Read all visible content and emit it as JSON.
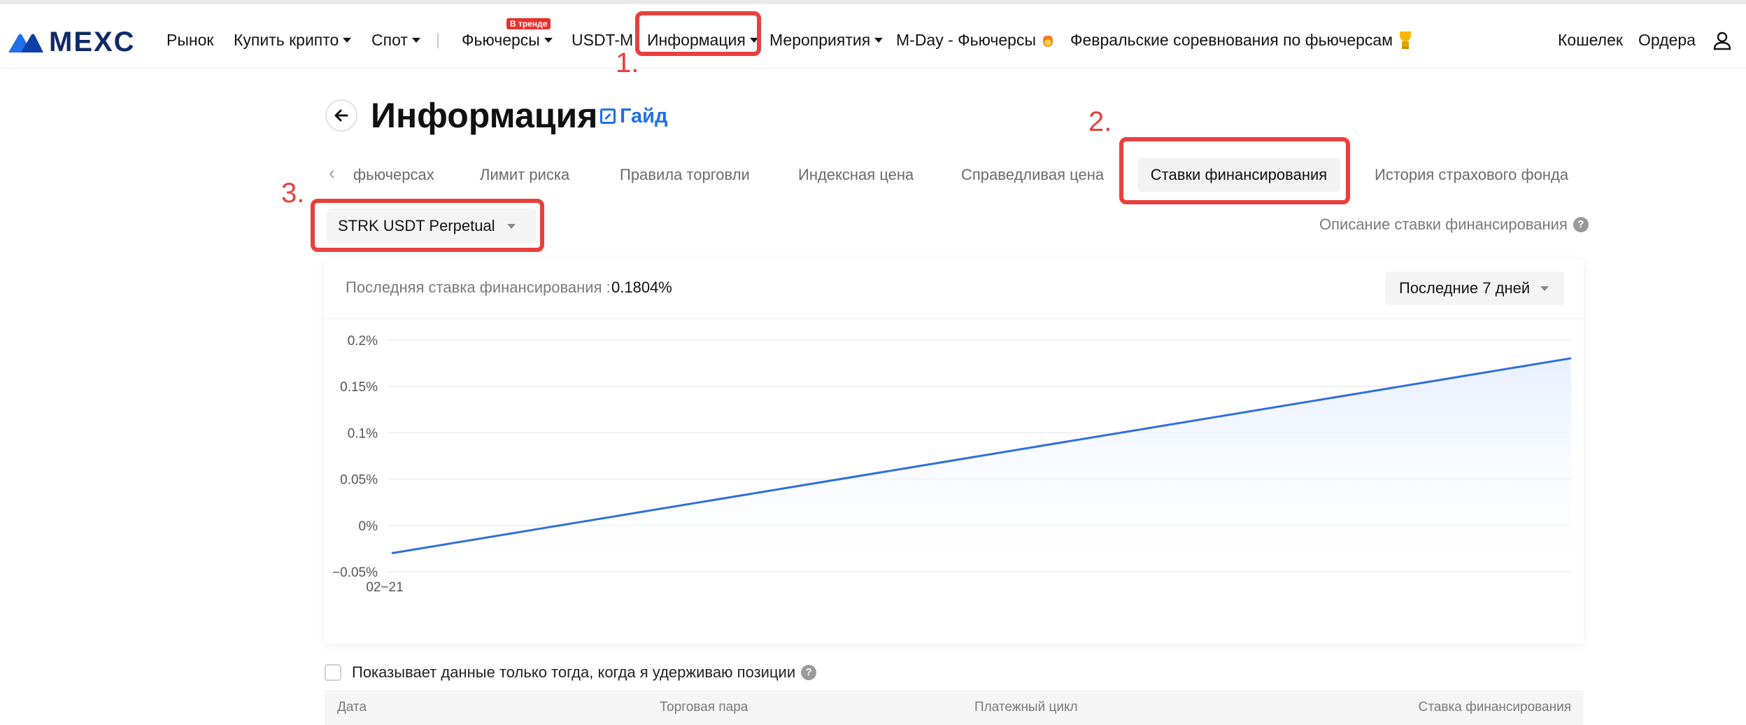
{
  "nav": {
    "logo": "MEXC",
    "items": [
      {
        "label": "Рынок"
      },
      {
        "label": "Купить крипто"
      },
      {
        "label": "Спот"
      },
      {
        "label": "Фьючерсы"
      },
      {
        "label": "USDT-M"
      },
      {
        "label": "Информация"
      },
      {
        "label": "Мероприятия"
      },
      {
        "label": "M-Day - Фьючерсы"
      },
      {
        "label": "Февральские соревнования по фьючерсам"
      }
    ],
    "trend_badge": "В тренде",
    "right": {
      "wallet": "Кошелек",
      "orders": "Ордера"
    }
  },
  "annotations": {
    "step1": "1.",
    "step2": "2.",
    "step3": "3."
  },
  "page": {
    "title": "Информация",
    "guide": "Гайд"
  },
  "tabs": [
    {
      "label": "фьючерсах"
    },
    {
      "label": "Лимит риска"
    },
    {
      "label": "Правила торговли"
    },
    {
      "label": "Индексная цена"
    },
    {
      "label": "Справедливая цена"
    },
    {
      "label": "Ставки финансирования",
      "active": true
    },
    {
      "label": "История страхового фонда"
    }
  ],
  "contract": {
    "selected": "STRK USDT Perpetual"
  },
  "description_link": "Описание ставки финансирования",
  "card": {
    "latest_label": "Последняя ставка финансирования :",
    "latest_value": "0.1804%",
    "period": "Последние 7 дней"
  },
  "chart_data": {
    "type": "area",
    "x": [
      "02-21",
      ""
    ],
    "series": [
      {
        "values": [
          -0.03,
          0.1804
        ]
      }
    ],
    "y_ticks": [
      "0.2%",
      "0.15%",
      "0.1%",
      "0.05%",
      "0%",
      "-0.05%"
    ],
    "ylim": [
      -0.05,
      0.2
    ],
    "x_tick_labels": [
      "02-21"
    ],
    "grid": true,
    "line_color": "#2f6fde",
    "fill_color": "#e8efff"
  },
  "filter": {
    "label": "Показывает данные только тогда, когда я удерживаю позиции"
  },
  "table": {
    "columns": [
      "Дата",
      "Торговая пара",
      "Платежный цикл",
      "Ставка финансирования"
    ]
  },
  "colors": {
    "accent": "#1f6feb",
    "annotation": "#e8403c",
    "logo": "#102a66"
  }
}
